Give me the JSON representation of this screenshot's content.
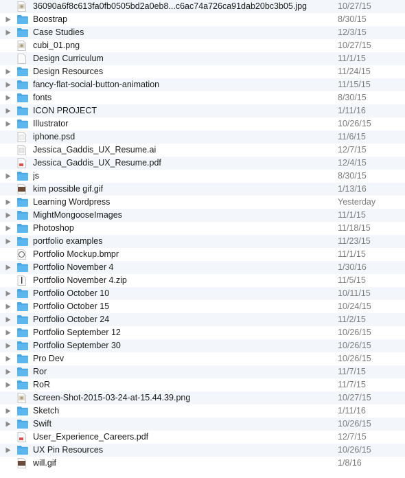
{
  "files": [
    {
      "name": "36090a6f8c613fa0fb0505bd2a0eb8...c6ac74a726ca91dab20bc3b05.jpg",
      "date": "10/27/15",
      "kind": "file",
      "icon": "jpg-file-icon"
    },
    {
      "name": "Boostrap",
      "date": "8/30/15",
      "kind": "folder",
      "icon": "folder-icon"
    },
    {
      "name": "Case Studies",
      "date": "12/3/15",
      "kind": "folder",
      "icon": "folder-icon"
    },
    {
      "name": "cubi_01.png",
      "date": "10/27/15",
      "kind": "file",
      "icon": "png-file-icon"
    },
    {
      "name": "Design Curriculum",
      "date": "11/1/15",
      "kind": "file",
      "icon": "document-file-icon"
    },
    {
      "name": "Design Resources",
      "date": "11/24/15",
      "kind": "folder",
      "icon": "folder-icon"
    },
    {
      "name": "fancy-flat-social-button-animation",
      "date": "11/15/15",
      "kind": "folder",
      "icon": "folder-icon"
    },
    {
      "name": "fonts",
      "date": "8/30/15",
      "kind": "folder",
      "icon": "folder-icon"
    },
    {
      "name": "ICON PROJECT",
      "date": "1/11/16",
      "kind": "folder",
      "icon": "folder-icon"
    },
    {
      "name": "Illustrator",
      "date": "10/26/15",
      "kind": "folder",
      "icon": "folder-icon"
    },
    {
      "name": "iphone.psd",
      "date": "11/6/15",
      "kind": "file",
      "icon": "psd-file-icon"
    },
    {
      "name": "Jessica_Gaddis_UX_Resume.ai",
      "date": "12/7/15",
      "kind": "file",
      "icon": "ai-file-icon"
    },
    {
      "name": "Jessica_Gaddis_UX_Resume.pdf",
      "date": "12/4/15",
      "kind": "file",
      "icon": "pdf-file-icon"
    },
    {
      "name": "js",
      "date": "8/30/15",
      "kind": "folder",
      "icon": "folder-icon"
    },
    {
      "name": "kim possible gif.gif",
      "date": "1/13/16",
      "kind": "file",
      "icon": "gif-file-icon"
    },
    {
      "name": "Learning Wordpress",
      "date": "Yesterday",
      "kind": "folder",
      "icon": "folder-icon"
    },
    {
      "name": "MightMongooseImages",
      "date": "11/1/15",
      "kind": "folder",
      "icon": "folder-icon"
    },
    {
      "name": "Photoshop",
      "date": "11/18/15",
      "kind": "folder",
      "icon": "folder-icon"
    },
    {
      "name": "portfolio examples",
      "date": "11/23/15",
      "kind": "folder",
      "icon": "folder-icon"
    },
    {
      "name": "Portfolio Mockup.bmpr",
      "date": "11/1/15",
      "kind": "file",
      "icon": "bmpr-file-icon"
    },
    {
      "name": "Portfolio November 4",
      "date": "1/30/16",
      "kind": "folder",
      "icon": "folder-icon"
    },
    {
      "name": "Portfolio November 4.zip",
      "date": "11/5/15",
      "kind": "file",
      "icon": "zip-file-icon"
    },
    {
      "name": "Portfolio October 10",
      "date": "10/11/15",
      "kind": "folder",
      "icon": "folder-icon"
    },
    {
      "name": "Portfolio October 15",
      "date": "10/24/15",
      "kind": "folder",
      "icon": "folder-icon"
    },
    {
      "name": "Portfolio October 24",
      "date": "11/2/15",
      "kind": "folder",
      "icon": "folder-icon"
    },
    {
      "name": "Portfolio September 12",
      "date": "10/26/15",
      "kind": "folder",
      "icon": "folder-icon"
    },
    {
      "name": "Portfolio September 30",
      "date": "10/26/15",
      "kind": "folder",
      "icon": "folder-icon"
    },
    {
      "name": "Pro Dev",
      "date": "10/26/15",
      "kind": "folder",
      "icon": "folder-icon"
    },
    {
      "name": "Ror",
      "date": "11/7/15",
      "kind": "folder",
      "icon": "folder-icon"
    },
    {
      "name": "RoR",
      "date": "11/7/15",
      "kind": "folder",
      "icon": "folder-icon"
    },
    {
      "name": "Screen-Shot-2015-03-24-at-15.44.39.png",
      "date": "10/27/15",
      "kind": "file",
      "icon": "png-file-icon"
    },
    {
      "name": "Sketch",
      "date": "1/11/16",
      "kind": "folder",
      "icon": "folder-icon"
    },
    {
      "name": "Swift",
      "date": "10/26/15",
      "kind": "folder",
      "icon": "folder-icon"
    },
    {
      "name": "User_Experience_Careers.pdf",
      "date": "12/7/15",
      "kind": "file",
      "icon": "pdf-file-icon"
    },
    {
      "name": "UX Pin Resources",
      "date": "10/26/15",
      "kind": "folder",
      "icon": "folder-icon"
    },
    {
      "name": "will.gif",
      "date": "1/8/16",
      "kind": "file",
      "icon": "gif-file-icon"
    }
  ],
  "colors": {
    "folder": "#5cb7ee",
    "folder_tab": "#4aa6e0",
    "disclosure": "#8a8a8a",
    "row_alt": "#f3f6fa",
    "date_text": "#7c7c7c"
  }
}
